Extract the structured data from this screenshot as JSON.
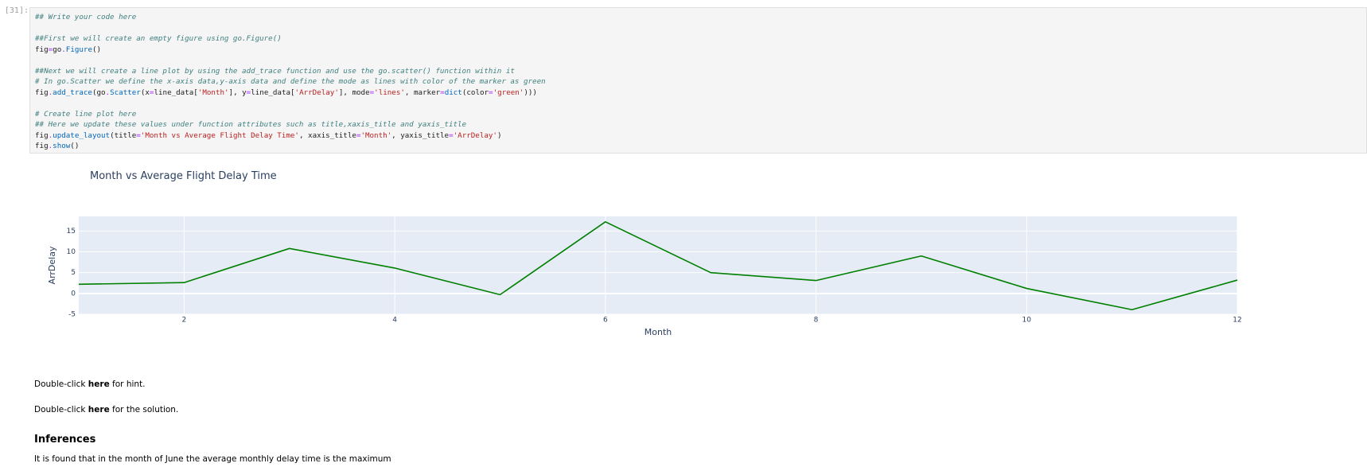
{
  "cell": {
    "prompt": "[31]:",
    "code_lines": [
      [
        {
          "t": "## Write your code here",
          "c": "cm"
        }
      ],
      [],
      [
        {
          "t": "##First we will create an empty figure using go.Figure()",
          "c": "cm"
        }
      ],
      [
        {
          "t": "fig",
          "c": ""
        },
        {
          "t": "=",
          "c": "op"
        },
        {
          "t": "go",
          "c": ""
        },
        {
          "t": ".",
          "c": "op"
        },
        {
          "t": "Figure",
          "c": "fn"
        },
        {
          "t": "()",
          "c": ""
        }
      ],
      [],
      [
        {
          "t": "##Next we will create a line plot by using the add_trace function and use the go.scatter() function within it",
          "c": "cm"
        }
      ],
      [
        {
          "t": "# In go.Scatter we define the x-axis data,y-axis data and define the mode as lines with color of the marker as green",
          "c": "cm"
        }
      ],
      [
        {
          "t": "fig",
          "c": ""
        },
        {
          "t": ".",
          "c": "op"
        },
        {
          "t": "add_trace",
          "c": "fn"
        },
        {
          "t": "(go",
          "c": ""
        },
        {
          "t": ".",
          "c": "op"
        },
        {
          "t": "Scatter",
          "c": "fn"
        },
        {
          "t": "(x",
          "c": ""
        },
        {
          "t": "=",
          "c": "op"
        },
        {
          "t": "line_data[",
          "c": ""
        },
        {
          "t": "'Month'",
          "c": "str"
        },
        {
          "t": "], y",
          "c": ""
        },
        {
          "t": "=",
          "c": "op"
        },
        {
          "t": "line_data[",
          "c": ""
        },
        {
          "t": "'ArrDelay'",
          "c": "str"
        },
        {
          "t": "], mode",
          "c": ""
        },
        {
          "t": "=",
          "c": "op"
        },
        {
          "t": "'lines'",
          "c": "str"
        },
        {
          "t": ", marker",
          "c": ""
        },
        {
          "t": "=",
          "c": "op"
        },
        {
          "t": "dict",
          "c": "fn"
        },
        {
          "t": "(color",
          "c": ""
        },
        {
          "t": "=",
          "c": "op"
        },
        {
          "t": "'green'",
          "c": "str"
        },
        {
          "t": ")))",
          "c": ""
        }
      ],
      [],
      [
        {
          "t": "# Create line plot here",
          "c": "cm"
        }
      ],
      [
        {
          "t": "## Here we update these values under function attributes such as title,xaxis_title and yaxis_title",
          "c": "cm"
        }
      ],
      [
        {
          "t": "fig",
          "c": ""
        },
        {
          "t": ".",
          "c": "op"
        },
        {
          "t": "update_layout",
          "c": "fn"
        },
        {
          "t": "(title",
          "c": ""
        },
        {
          "t": "=",
          "c": "op"
        },
        {
          "t": "'Month vs Average Flight Delay Time'",
          "c": "str"
        },
        {
          "t": ", xaxis_title",
          "c": ""
        },
        {
          "t": "=",
          "c": "op"
        },
        {
          "t": "'Month'",
          "c": "str"
        },
        {
          "t": ", yaxis_title",
          "c": ""
        },
        {
          "t": "=",
          "c": "op"
        },
        {
          "t": "'ArrDelay'",
          "c": "str"
        },
        {
          "t": ")",
          "c": ""
        }
      ],
      [
        {
          "t": "fig",
          "c": ""
        },
        {
          "t": ".",
          "c": "op"
        },
        {
          "t": "show",
          "c": "fn"
        },
        {
          "t": "()",
          "c": ""
        }
      ]
    ]
  },
  "chart_data": {
    "type": "line",
    "title": "Month vs Average Flight Delay Time",
    "xlabel": "Month",
    "ylabel": "ArrDelay",
    "x": [
      1,
      2,
      3,
      4,
      5,
      6,
      7,
      8,
      9,
      10,
      11,
      12
    ],
    "series": [
      {
        "values": [
          2.2,
          2.6,
          10.8,
          6.1,
          -0.3,
          17.2,
          5.0,
          3.1,
          9.0,
          1.2,
          -3.9,
          3.2
        ]
      }
    ],
    "xlim": [
      1,
      12
    ],
    "ylim": [
      -5,
      18.5
    ],
    "x_ticks": [
      2,
      4,
      6,
      8,
      10,
      12
    ],
    "y_ticks": [
      -5,
      0,
      5,
      10,
      15
    ],
    "line_color": "#008000",
    "plot_bg": "#e5ecf6",
    "grid": true
  },
  "markdown": {
    "hint_pre": "Double-click ",
    "hint_link": "here",
    "hint_post": " for hint.",
    "solution_pre": "Double-click ",
    "solution_link": "here",
    "solution_post": " for the solution.",
    "heading": "Inferences",
    "paragraph": "It is found that in the month of June the average monthly delay time is the maximum"
  }
}
